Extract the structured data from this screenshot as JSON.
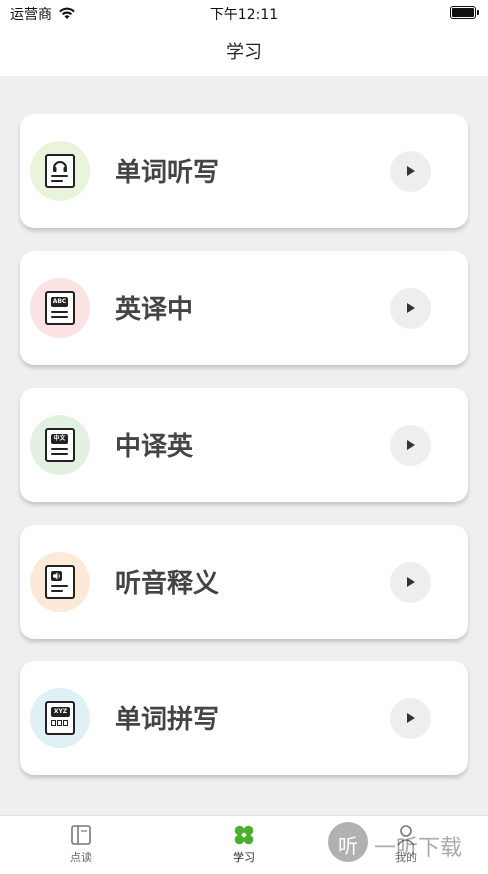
{
  "status": {
    "carrier": "运营商",
    "time": "下午12:11"
  },
  "nav": {
    "title": "学习"
  },
  "cards": [
    {
      "label": "单词听写",
      "icon": "headphones-doc-icon",
      "circle_color": "#eaf3dc"
    },
    {
      "label": "英译中",
      "icon": "abc-doc-icon",
      "circle_color": "#fbe3e3",
      "badge": "ABC"
    },
    {
      "label": "中译英",
      "icon": "zhongwen-doc-icon",
      "circle_color": "#e2f1e1",
      "badge": "中文"
    },
    {
      "label": "听音释义",
      "icon": "speaker-doc-icon",
      "circle_color": "#fde9d8"
    },
    {
      "label": "单词拼写",
      "icon": "spelling-doc-icon",
      "circle_color": "#dff1f4",
      "badge": "XYZ"
    }
  ],
  "tabs": [
    {
      "label": "点读",
      "icon": "book-icon",
      "active": false
    },
    {
      "label": "学习",
      "icon": "clover-icon",
      "active": true,
      "color": "#4caf2a"
    },
    {
      "label": "我的",
      "icon": "person-icon",
      "active": false
    }
  ],
  "watermark": {
    "text": "一听下载",
    "logo_char": "听"
  }
}
